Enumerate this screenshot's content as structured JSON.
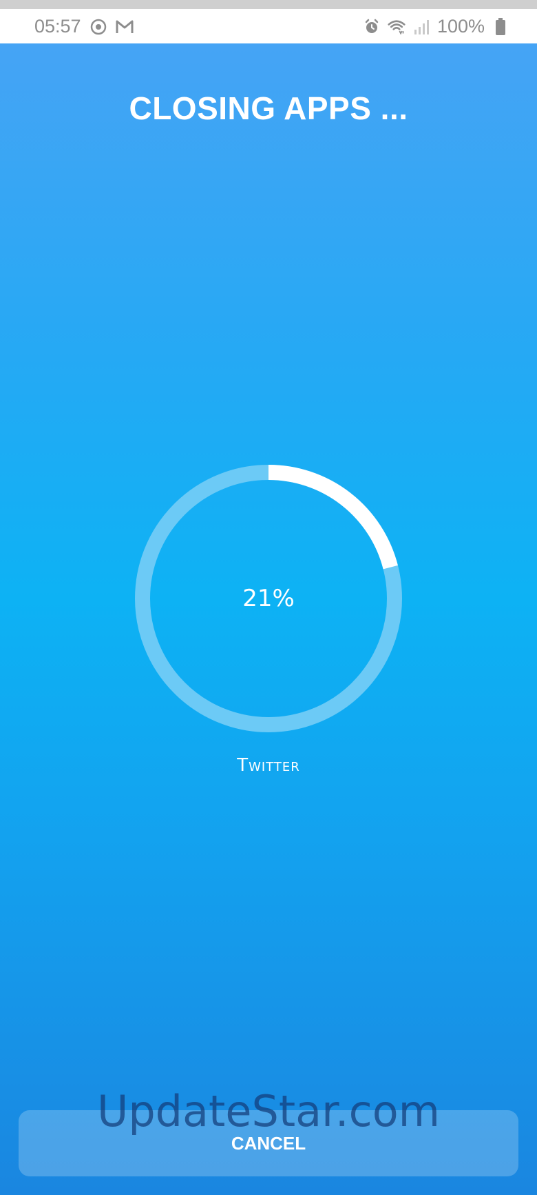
{
  "status_bar": {
    "time": "05:57",
    "battery": "100%",
    "icons_left": [
      "sync-icon",
      "gmail-icon"
    ],
    "icons_right": [
      "alarm-icon",
      "wifi-icon",
      "signal-icon",
      "battery-icon"
    ]
  },
  "main": {
    "title": "CLOSING APPS ...",
    "progress_percent": 21,
    "progress_label": "21%",
    "app_name": "Twitter"
  },
  "actions": {
    "cancel_label": "CANCEL"
  },
  "watermark": {
    "text": "UpdateStar.com"
  },
  "colors": {
    "ring_track": "#6ccaf6",
    "ring_fill": "#ffffff",
    "text": "#ffffff"
  }
}
